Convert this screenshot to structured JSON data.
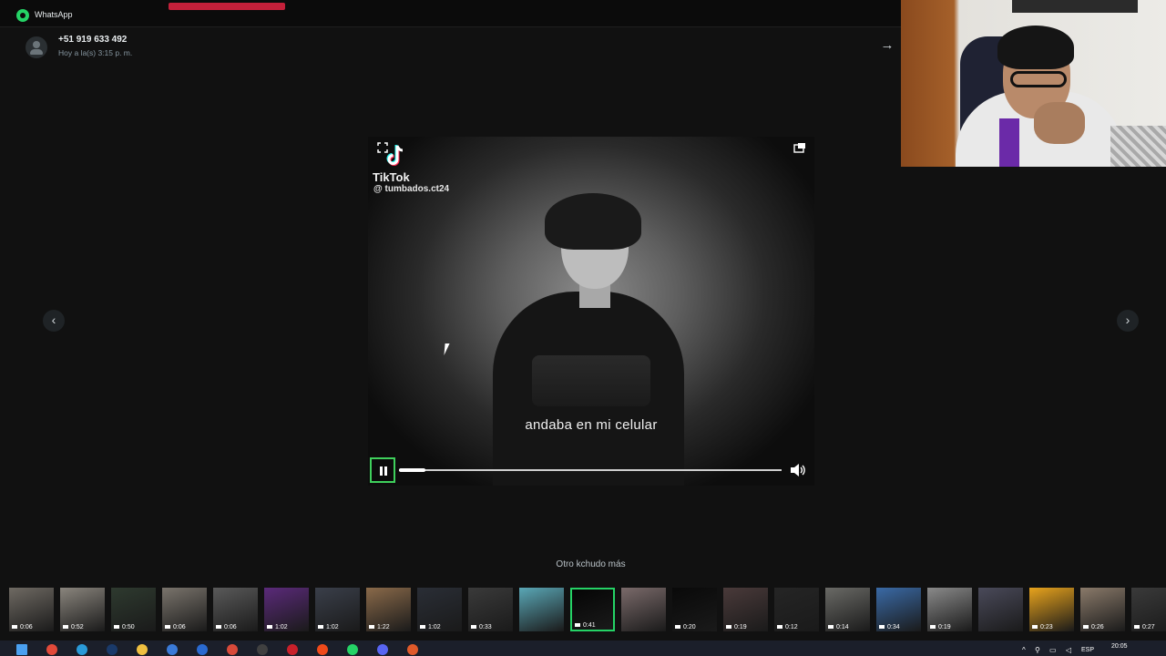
{
  "titlebar": {
    "app_name": "WhatsApp",
    "icon": "whatsapp-icon"
  },
  "contact": {
    "name": "+51 919 633 492",
    "time": "Hoy a la(s) 3:15 p. m."
  },
  "video": {
    "watermark_brand": "TikTok",
    "watermark_handle": "@ tumbados.ct24",
    "caption": "andaba en mi celular",
    "progress": 0.07,
    "state": "playing"
  },
  "media_caption": "Otro kchudo más",
  "thumbnails": [
    {
      "duration": "0:06",
      "color": "#6f6a63"
    },
    {
      "duration": "0:52",
      "color": "#8a857d"
    },
    {
      "duration": "0:50",
      "color": "#2e3a2f"
    },
    {
      "duration": "0:06",
      "color": "#7a746c"
    },
    {
      "duration": "0:06",
      "color": "#5a5a5a"
    },
    {
      "duration": "1:02",
      "color": "#5b2a7a"
    },
    {
      "duration": "1:02",
      "color": "#3a3f4a"
    },
    {
      "duration": "1:22",
      "color": "#8a6a4a"
    },
    {
      "duration": "1:02",
      "color": "#2a2e36"
    },
    {
      "duration": "0:33",
      "color": "#3a3a3a"
    },
    {
      "duration": "",
      "color": "#5aa7b6"
    },
    {
      "duration": "0:41",
      "color": "#050505"
    },
    {
      "duration": "",
      "color": "#7a6a6a"
    },
    {
      "duration": "0:20",
      "color": "#090909"
    },
    {
      "duration": "0:19",
      "color": "#4a3a3a"
    },
    {
      "duration": "0:12",
      "color": "#252525"
    },
    {
      "duration": "0:14",
      "color": "#6a6a66"
    },
    {
      "duration": "0:34",
      "color": "#3a6aa6"
    },
    {
      "duration": "0:19",
      "color": "#8a8a8a"
    },
    {
      "duration": "",
      "color": "#4a4a5a"
    },
    {
      "duration": "0:23",
      "color": "#e8a31c"
    },
    {
      "duration": "0:26",
      "color": "#8a7a6a"
    },
    {
      "duration": "0:27",
      "color": "#3a3a3a"
    }
  ],
  "selected_thumbnail": 11,
  "taskbar": {
    "icons": [
      {
        "name": "windows-start-icon",
        "color": "#4aa0f0"
      },
      {
        "name": "chrome-icon",
        "color": "#e24a3a"
      },
      {
        "name": "edge-icon",
        "color": "#2a9ad8"
      },
      {
        "name": "photoshop-icon",
        "color": "#1a3a6a"
      },
      {
        "name": "file-explorer-icon",
        "color": "#f0c040"
      },
      {
        "name": "store-icon",
        "color": "#3a7ad8"
      },
      {
        "name": "mail-icon",
        "color": "#2a6ad0"
      },
      {
        "name": "calendar-icon",
        "color": "#d84a3a"
      },
      {
        "name": "obs-icon",
        "color": "#404040"
      },
      {
        "name": "opera-icon",
        "color": "#c8202a"
      },
      {
        "name": "brave-icon",
        "color": "#f04a1a"
      },
      {
        "name": "whatsapp-taskbar-icon",
        "color": "#25d366"
      },
      {
        "name": "discord-icon",
        "color": "#5865f2"
      },
      {
        "name": "media-player-icon",
        "color": "#e05a2a"
      }
    ],
    "language": "ESP",
    "time": "20:05"
  },
  "colors": {
    "accent": "#25d366",
    "background": "#111111",
    "selected_outline": "#3fd05c"
  }
}
